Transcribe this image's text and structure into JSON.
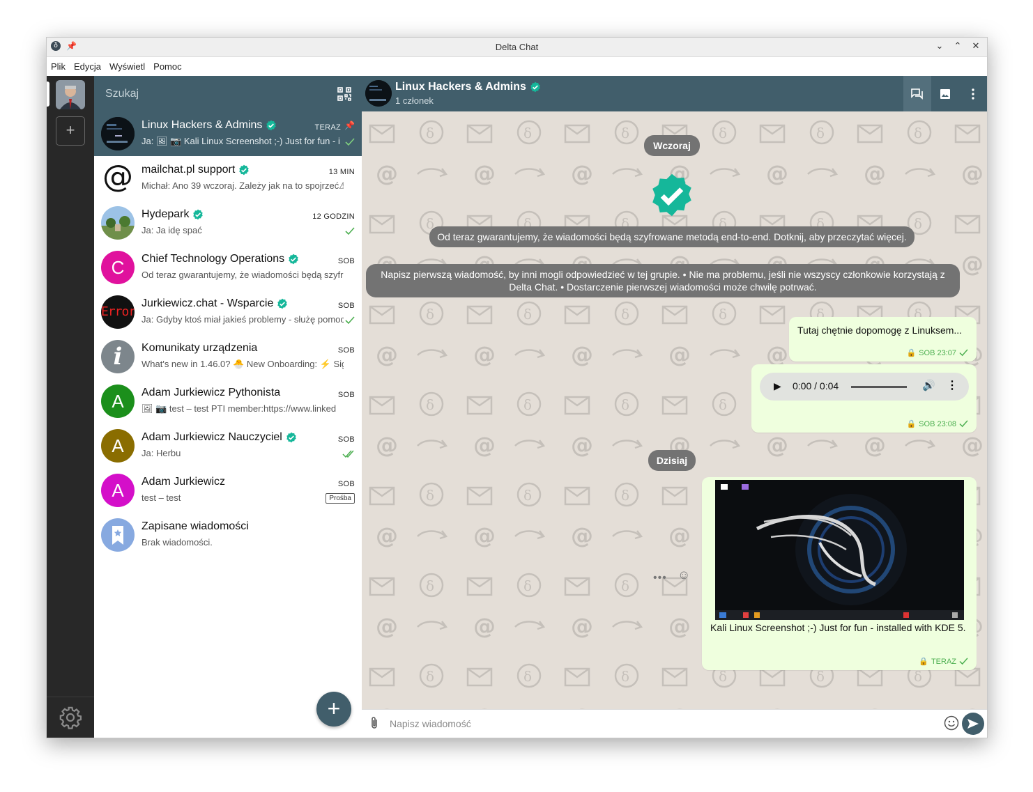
{
  "window": {
    "title": "Delta Chat"
  },
  "menu": [
    "Plik",
    "Edycja",
    "Wyświetl",
    "Pomoc"
  ],
  "search": {
    "placeholder": "Szukaj"
  },
  "chats": [
    {
      "name": "Linux Hackers & Admins",
      "verified": true,
      "time": "TERAZ",
      "pinned": true,
      "preview": "Ja: 🖼 📷 Kali Linux Screenshot ;-) Just for fun - i",
      "status": "sent"
    },
    {
      "name": "mailchat.pl support",
      "verified": true,
      "time": "13 MIN",
      "preview": "Michał: Ano 39 wczoraj. Zależy jak na to spojrzeć⚠"
    },
    {
      "name": "Hydepark",
      "verified": true,
      "time": "12 GODZIN",
      "preview": "Ja: Ja idę spać",
      "status": "sent"
    },
    {
      "name": "Chief Technology Operations",
      "verified": true,
      "time": "SOB",
      "preview": "Od teraz gwarantujemy, że wiadomości będą szyfr",
      "avatar_letter": "C",
      "avatar_color": "#e0119d"
    },
    {
      "name": "Jurkiewicz.chat - Wsparcie",
      "verified": true,
      "time": "SOB",
      "preview": "Ja: Gdyby ktoś miał jakieś problemy - służę pomoc",
      "status": "sent"
    },
    {
      "name": "Komunikaty urządzenia",
      "verified": false,
      "time": "SOB",
      "preview": "What's new in 1.46.0? 🐣 New Onboarding: ⚡ Sig"
    },
    {
      "name": "Adam Jurkiewicz Pythonista",
      "verified": false,
      "time": "SOB",
      "preview": "🖼 📷 test – test PTI member:https://www.linked",
      "avatar_letter": "A",
      "avatar_color": "#1b8f1b"
    },
    {
      "name": "Adam Jurkiewicz Nauczyciel",
      "verified": true,
      "time": "SOB",
      "preview": "Ja: Herbu",
      "status": "read",
      "avatar_letter": "A",
      "avatar_color": "#8a6d00"
    },
    {
      "name": "Adam Jurkiewicz",
      "verified": false,
      "time": "SOB",
      "preview": "test – test",
      "badge": "Prośba",
      "avatar_letter": "A",
      "avatar_color": "#d40fc9"
    },
    {
      "name": "Zapisane wiadomości",
      "verified": false,
      "time": "",
      "preview": "Brak wiadomości."
    }
  ],
  "header": {
    "title": "Linux Hackers & Admins",
    "subtitle": "1 członek"
  },
  "messages": {
    "day1": "Wczoraj",
    "e2e_notice": "Od teraz gwarantujemy, że wiadomości będą szyfrowane metodą end-to-end. Dotknij, aby przeczytać więcej.",
    "group_notice": "Napisz pierwszą wiadomość, by inni mogli odpowiedzieć w tej grupie. • Nie ma problemu, jeśli nie wszyscy członkowie korzystają z Delta Chat. • Dostarczenie pierwszej wiadomości może chwilę potrwać.",
    "msg1_text": "Tutaj chętnie dopomogę z Linuksem...",
    "msg1_time": "SOB 23:07",
    "audio_time": "0:00 / 0:04",
    "msg2_time": "SOB 23:08",
    "day2": "Dzisiaj",
    "msg3_caption": "Kali Linux Screenshot ;-) Just for fun - installed with KDE 5.",
    "msg3_time": "TERAZ"
  },
  "composer": {
    "placeholder": "Napisz wiadomość"
  },
  "colors": {
    "accent": "#415e6b",
    "verified": "#15b79a",
    "bubble": "#efffde",
    "chat_bg": "#e4ded7"
  }
}
